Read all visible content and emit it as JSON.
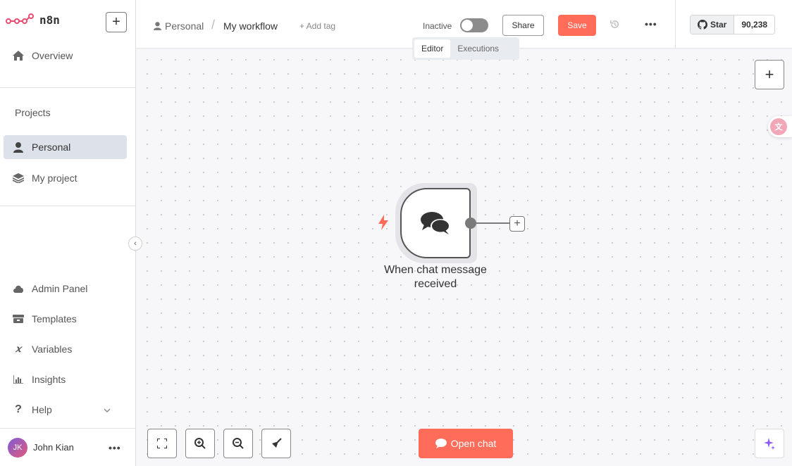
{
  "app": {
    "name": "n8n"
  },
  "sidebar": {
    "new_label": "+",
    "overview": "Overview",
    "projects_heading": "Projects",
    "projects": [
      {
        "label": "Personal",
        "icon": "user-icon",
        "active": true
      },
      {
        "label": "My project",
        "icon": "layers-icon",
        "active": false
      }
    ],
    "bottom_items": [
      {
        "label": "Admin Panel",
        "icon": "cloud-icon"
      },
      {
        "label": "Templates",
        "icon": "box-icon"
      },
      {
        "label": "Variables",
        "icon": "variable-icon"
      },
      {
        "label": "Insights",
        "icon": "chart-icon"
      },
      {
        "label": "Help",
        "icon": "question-icon"
      }
    ],
    "user": {
      "initials": "JK",
      "name": "John Kian"
    }
  },
  "header": {
    "breadcrumb_project": "Personal",
    "breadcrumb_sep": "/",
    "workflow_name": "My workflow",
    "add_tag": "+ Add tag",
    "status_label": "Inactive",
    "share_label": "Share",
    "save_label": "Save",
    "github": {
      "label": "Star",
      "count": "90,238"
    }
  },
  "tabs": [
    {
      "label": "Editor",
      "active": true
    },
    {
      "label": "Executions",
      "active": false
    }
  ],
  "canvas": {
    "node": {
      "label": "When chat message received",
      "icon": "chat-bubbles-icon"
    },
    "open_chat_label": "Open chat"
  },
  "colors": {
    "accent": "#ff6d5a",
    "active_nav": "#dde1ea"
  }
}
